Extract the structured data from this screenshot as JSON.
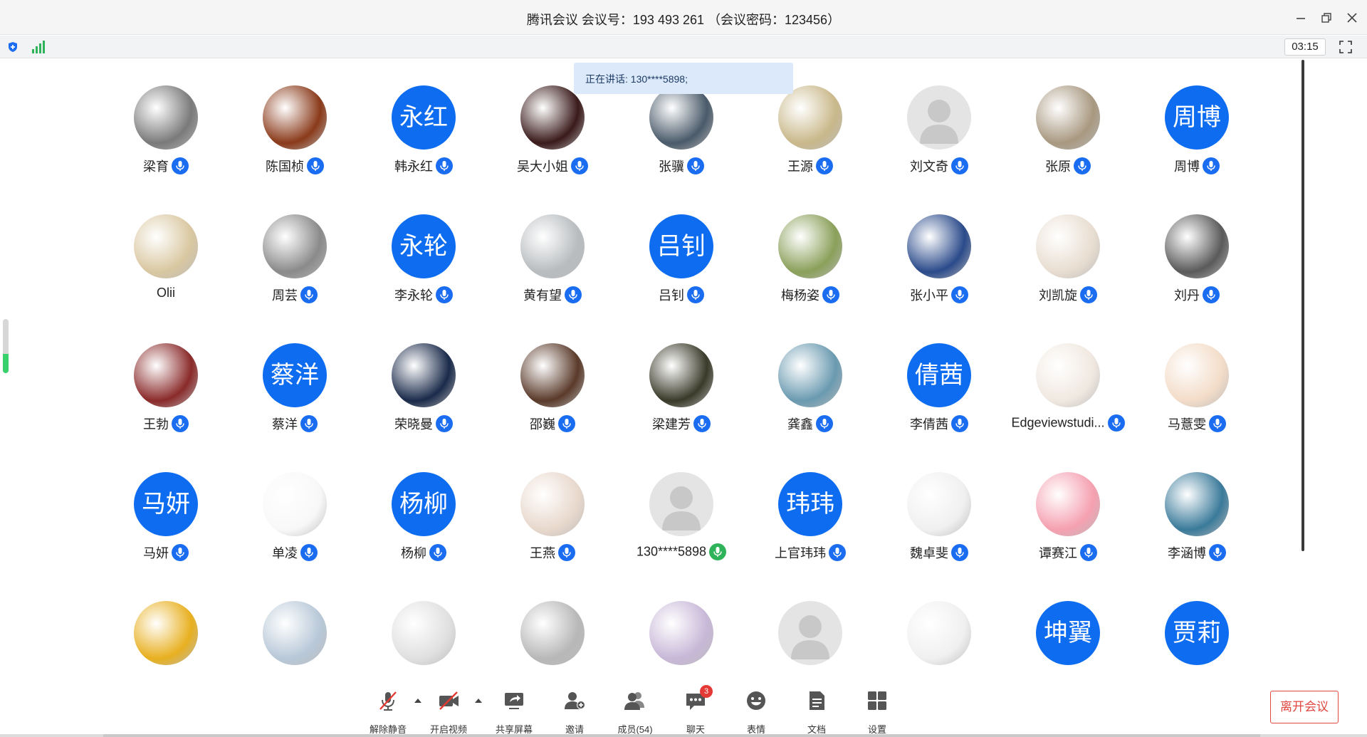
{
  "window": {
    "title": "腾讯会议 会议号：193 493 261 （会议密码：123456）"
  },
  "status": {
    "timer": "03:15"
  },
  "speaking": {
    "text": "正在讲话: 130****5898;"
  },
  "participants": [
    {
      "name": "梁育",
      "avatar": "photo",
      "color": "#7a7a7a",
      "mic": "blue"
    },
    {
      "name": "陈国桢",
      "avatar": "photo",
      "color": "#8a3a1a",
      "mic": "blue"
    },
    {
      "name": "韩永红",
      "avatar": "text",
      "avatar_text": "永红",
      "mic": "blue"
    },
    {
      "name": "吴大小姐",
      "avatar": "photo",
      "color": "#3a1a1a",
      "mic": "blue"
    },
    {
      "name": "张骥",
      "avatar": "photo",
      "color": "#4a5a6a",
      "mic": "blue"
    },
    {
      "name": "王源",
      "avatar": "photo",
      "color": "#c9b88a",
      "mic": "blue"
    },
    {
      "name": "刘文奇",
      "avatar": "default",
      "color": "#d8d8d8",
      "mic": "blue"
    },
    {
      "name": "张原",
      "avatar": "photo",
      "color": "#a89880",
      "mic": "blue"
    },
    {
      "name": "周博",
      "avatar": "text",
      "avatar_text": "周博",
      "mic": "blue"
    },
    {
      "name": "Olii",
      "avatar": "photo",
      "color": "#d9c7a0",
      "mic": "none"
    },
    {
      "name": "周芸",
      "avatar": "photo",
      "color": "#8a8a8a",
      "mic": "blue"
    },
    {
      "name": "李永轮",
      "avatar": "text",
      "avatar_text": "永轮",
      "mic": "blue"
    },
    {
      "name": "黄有望",
      "avatar": "photo",
      "color": "#b8bcbf",
      "mic": "blue"
    },
    {
      "name": "吕钊",
      "avatar": "text",
      "avatar_text": "吕钊",
      "mic": "blue"
    },
    {
      "name": "梅杨姿",
      "avatar": "photo",
      "color": "#8aa05a",
      "mic": "blue"
    },
    {
      "name": "张小平",
      "avatar": "photo",
      "color": "#2a4a8a",
      "mic": "blue"
    },
    {
      "name": "刘凯旋",
      "avatar": "photo",
      "color": "#e8ddd0",
      "mic": "blue"
    },
    {
      "name": "刘丹",
      "avatar": "photo",
      "color": "#5a5a5a",
      "mic": "blue"
    },
    {
      "name": "王勃",
      "avatar": "photo",
      "color": "#8a2a2a",
      "mic": "blue"
    },
    {
      "name": "蔡洋",
      "avatar": "text",
      "avatar_text": "蔡洋",
      "mic": "blue"
    },
    {
      "name": "荣晓曼",
      "avatar": "photo",
      "color": "#1a2a4a",
      "mic": "blue"
    },
    {
      "name": "邵巍",
      "avatar": "photo",
      "color": "#5a3a2a",
      "mic": "blue"
    },
    {
      "name": "梁建芳",
      "avatar": "photo",
      "color": "#3a3a2a",
      "mic": "blue"
    },
    {
      "name": "龚鑫",
      "avatar": "photo",
      "color": "#6a9ab0",
      "mic": "blue"
    },
    {
      "name": "李倩茜",
      "avatar": "text",
      "avatar_text": "倩茜",
      "mic": "blue"
    },
    {
      "name": "Edgeviewstudi...",
      "avatar": "photo",
      "color": "#f0e8e0",
      "mic": "blue"
    },
    {
      "name": "马薏雯",
      "avatar": "photo",
      "color": "#f3dcc8",
      "mic": "blue"
    },
    {
      "name": "马妍",
      "avatar": "text",
      "avatar_text": "马妍",
      "mic": "blue"
    },
    {
      "name": "单凌",
      "avatar": "photo",
      "color": "#f8f8f8",
      "mic": "blue"
    },
    {
      "name": "杨柳",
      "avatar": "text",
      "avatar_text": "杨柳",
      "mic": "blue"
    },
    {
      "name": "王燕",
      "avatar": "photo",
      "color": "#e8d8cc",
      "mic": "blue"
    },
    {
      "name": "130****5898",
      "avatar": "default",
      "color": "#d8d8d8",
      "mic": "green"
    },
    {
      "name": "上官玮玮",
      "avatar": "text",
      "avatar_text": "玮玮",
      "mic": "blue"
    },
    {
      "name": "魏卓斐",
      "avatar": "photo",
      "color": "#f0f0f0",
      "mic": "blue"
    },
    {
      "name": "谭赛江",
      "avatar": "photo",
      "color": "#f5a0b0",
      "mic": "blue"
    },
    {
      "name": "李涵博",
      "avatar": "photo",
      "color": "#3a7a9a",
      "mic": "blue"
    },
    {
      "name": "",
      "avatar": "photo",
      "color": "#e8b020",
      "mic": "hidden"
    },
    {
      "name": "",
      "avatar": "photo",
      "color": "#b8c8d8",
      "mic": "hidden"
    },
    {
      "name": "",
      "avatar": "photo",
      "color": "#e0e0e0",
      "mic": "hidden"
    },
    {
      "name": "",
      "avatar": "photo",
      "color": "#b8b8b8",
      "mic": "hidden"
    },
    {
      "name": "",
      "avatar": "photo",
      "color": "#c8b8d8",
      "mic": "hidden"
    },
    {
      "name": "",
      "avatar": "default",
      "color": "#d8d8d8",
      "mic": "hidden"
    },
    {
      "name": "",
      "avatar": "photo",
      "color": "#f0f0f0",
      "mic": "hidden"
    },
    {
      "name": "",
      "avatar": "text",
      "avatar_text": "坤翼",
      "mic": "hidden"
    },
    {
      "name": "",
      "avatar": "text",
      "avatar_text": "贾莉",
      "mic": "hidden"
    }
  ],
  "toolbar": {
    "unmute": "解除静音",
    "start_video": "开启视频",
    "share_screen": "共享屏幕",
    "invite": "邀请",
    "members": "成员(54)",
    "chat": "聊天",
    "chat_badge": "3",
    "emoji": "表情",
    "docs": "文档",
    "settings": "设置",
    "leave": "离开会议"
  },
  "volume_level": 0.35,
  "colors": {
    "accent": "#0e6cf0",
    "leave": "#e0473f",
    "speaking_bg": "#dbe9fb",
    "active_mic": "#2fb35a"
  }
}
